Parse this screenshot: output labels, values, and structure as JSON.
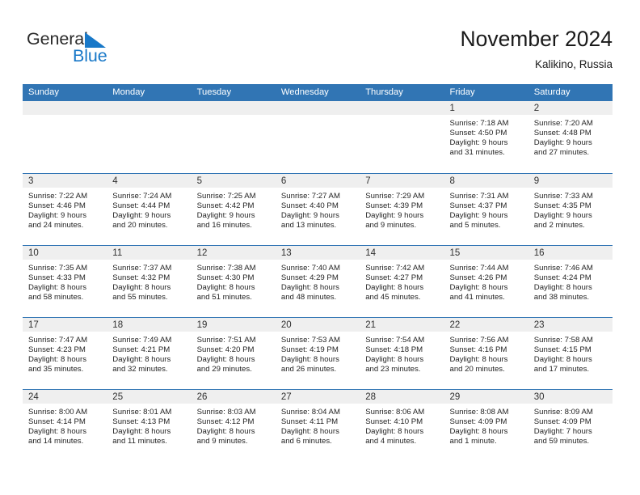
{
  "brand": {
    "name_top": "General",
    "name_bottom": "Blue",
    "triangle_color": "#1878c8",
    "text_color": "#2b2b2b"
  },
  "header": {
    "title": "November 2024",
    "subtitle": "Kalikino, Russia"
  },
  "theme": {
    "header_blue": "#3175b4",
    "daynum_band": "#efefef",
    "text": "#242424"
  },
  "weekdays": [
    "Sunday",
    "Monday",
    "Tuesday",
    "Wednesday",
    "Thursday",
    "Friday",
    "Saturday"
  ],
  "weeks": [
    [
      {
        "day": "",
        "sunrise": "",
        "sunset": "",
        "daylight_line1": "",
        "daylight_line2": ""
      },
      {
        "day": "",
        "sunrise": "",
        "sunset": "",
        "daylight_line1": "",
        "daylight_line2": ""
      },
      {
        "day": "",
        "sunrise": "",
        "sunset": "",
        "daylight_line1": "",
        "daylight_line2": ""
      },
      {
        "day": "",
        "sunrise": "",
        "sunset": "",
        "daylight_line1": "",
        "daylight_line2": ""
      },
      {
        "day": "",
        "sunrise": "",
        "sunset": "",
        "daylight_line1": "",
        "daylight_line2": ""
      },
      {
        "day": "1",
        "sunrise": "Sunrise: 7:18 AM",
        "sunset": "Sunset: 4:50 PM",
        "daylight_line1": "Daylight: 9 hours",
        "daylight_line2": "and 31 minutes."
      },
      {
        "day": "2",
        "sunrise": "Sunrise: 7:20 AM",
        "sunset": "Sunset: 4:48 PM",
        "daylight_line1": "Daylight: 9 hours",
        "daylight_line2": "and 27 minutes."
      }
    ],
    [
      {
        "day": "3",
        "sunrise": "Sunrise: 7:22 AM",
        "sunset": "Sunset: 4:46 PM",
        "daylight_line1": "Daylight: 9 hours",
        "daylight_line2": "and 24 minutes."
      },
      {
        "day": "4",
        "sunrise": "Sunrise: 7:24 AM",
        "sunset": "Sunset: 4:44 PM",
        "daylight_line1": "Daylight: 9 hours",
        "daylight_line2": "and 20 minutes."
      },
      {
        "day": "5",
        "sunrise": "Sunrise: 7:25 AM",
        "sunset": "Sunset: 4:42 PM",
        "daylight_line1": "Daylight: 9 hours",
        "daylight_line2": "and 16 minutes."
      },
      {
        "day": "6",
        "sunrise": "Sunrise: 7:27 AM",
        "sunset": "Sunset: 4:40 PM",
        "daylight_line1": "Daylight: 9 hours",
        "daylight_line2": "and 13 minutes."
      },
      {
        "day": "7",
        "sunrise": "Sunrise: 7:29 AM",
        "sunset": "Sunset: 4:39 PM",
        "daylight_line1": "Daylight: 9 hours",
        "daylight_line2": "and 9 minutes."
      },
      {
        "day": "8",
        "sunrise": "Sunrise: 7:31 AM",
        "sunset": "Sunset: 4:37 PM",
        "daylight_line1": "Daylight: 9 hours",
        "daylight_line2": "and 5 minutes."
      },
      {
        "day": "9",
        "sunrise": "Sunrise: 7:33 AM",
        "sunset": "Sunset: 4:35 PM",
        "daylight_line1": "Daylight: 9 hours",
        "daylight_line2": "and 2 minutes."
      }
    ],
    [
      {
        "day": "10",
        "sunrise": "Sunrise: 7:35 AM",
        "sunset": "Sunset: 4:33 PM",
        "daylight_line1": "Daylight: 8 hours",
        "daylight_line2": "and 58 minutes."
      },
      {
        "day": "11",
        "sunrise": "Sunrise: 7:37 AM",
        "sunset": "Sunset: 4:32 PM",
        "daylight_line1": "Daylight: 8 hours",
        "daylight_line2": "and 55 minutes."
      },
      {
        "day": "12",
        "sunrise": "Sunrise: 7:38 AM",
        "sunset": "Sunset: 4:30 PM",
        "daylight_line1": "Daylight: 8 hours",
        "daylight_line2": "and 51 minutes."
      },
      {
        "day": "13",
        "sunrise": "Sunrise: 7:40 AM",
        "sunset": "Sunset: 4:29 PM",
        "daylight_line1": "Daylight: 8 hours",
        "daylight_line2": "and 48 minutes."
      },
      {
        "day": "14",
        "sunrise": "Sunrise: 7:42 AM",
        "sunset": "Sunset: 4:27 PM",
        "daylight_line1": "Daylight: 8 hours",
        "daylight_line2": "and 45 minutes."
      },
      {
        "day": "15",
        "sunrise": "Sunrise: 7:44 AM",
        "sunset": "Sunset: 4:26 PM",
        "daylight_line1": "Daylight: 8 hours",
        "daylight_line2": "and 41 minutes."
      },
      {
        "day": "16",
        "sunrise": "Sunrise: 7:46 AM",
        "sunset": "Sunset: 4:24 PM",
        "daylight_line1": "Daylight: 8 hours",
        "daylight_line2": "and 38 minutes."
      }
    ],
    [
      {
        "day": "17",
        "sunrise": "Sunrise: 7:47 AM",
        "sunset": "Sunset: 4:23 PM",
        "daylight_line1": "Daylight: 8 hours",
        "daylight_line2": "and 35 minutes."
      },
      {
        "day": "18",
        "sunrise": "Sunrise: 7:49 AM",
        "sunset": "Sunset: 4:21 PM",
        "daylight_line1": "Daylight: 8 hours",
        "daylight_line2": "and 32 minutes."
      },
      {
        "day": "19",
        "sunrise": "Sunrise: 7:51 AM",
        "sunset": "Sunset: 4:20 PM",
        "daylight_line1": "Daylight: 8 hours",
        "daylight_line2": "and 29 minutes."
      },
      {
        "day": "20",
        "sunrise": "Sunrise: 7:53 AM",
        "sunset": "Sunset: 4:19 PM",
        "daylight_line1": "Daylight: 8 hours",
        "daylight_line2": "and 26 minutes."
      },
      {
        "day": "21",
        "sunrise": "Sunrise: 7:54 AM",
        "sunset": "Sunset: 4:18 PM",
        "daylight_line1": "Daylight: 8 hours",
        "daylight_line2": "and 23 minutes."
      },
      {
        "day": "22",
        "sunrise": "Sunrise: 7:56 AM",
        "sunset": "Sunset: 4:16 PM",
        "daylight_line1": "Daylight: 8 hours",
        "daylight_line2": "and 20 minutes."
      },
      {
        "day": "23",
        "sunrise": "Sunrise: 7:58 AM",
        "sunset": "Sunset: 4:15 PM",
        "daylight_line1": "Daylight: 8 hours",
        "daylight_line2": "and 17 minutes."
      }
    ],
    [
      {
        "day": "24",
        "sunrise": "Sunrise: 8:00 AM",
        "sunset": "Sunset: 4:14 PM",
        "daylight_line1": "Daylight: 8 hours",
        "daylight_line2": "and 14 minutes."
      },
      {
        "day": "25",
        "sunrise": "Sunrise: 8:01 AM",
        "sunset": "Sunset: 4:13 PM",
        "daylight_line1": "Daylight: 8 hours",
        "daylight_line2": "and 11 minutes."
      },
      {
        "day": "26",
        "sunrise": "Sunrise: 8:03 AM",
        "sunset": "Sunset: 4:12 PM",
        "daylight_line1": "Daylight: 8 hours",
        "daylight_line2": "and 9 minutes."
      },
      {
        "day": "27",
        "sunrise": "Sunrise: 8:04 AM",
        "sunset": "Sunset: 4:11 PM",
        "daylight_line1": "Daylight: 8 hours",
        "daylight_line2": "and 6 minutes."
      },
      {
        "day": "28",
        "sunrise": "Sunrise: 8:06 AM",
        "sunset": "Sunset: 4:10 PM",
        "daylight_line1": "Daylight: 8 hours",
        "daylight_line2": "and 4 minutes."
      },
      {
        "day": "29",
        "sunrise": "Sunrise: 8:08 AM",
        "sunset": "Sunset: 4:09 PM",
        "daylight_line1": "Daylight: 8 hours",
        "daylight_line2": "and 1 minute."
      },
      {
        "day": "30",
        "sunrise": "Sunrise: 8:09 AM",
        "sunset": "Sunset: 4:09 PM",
        "daylight_line1": "Daylight: 7 hours",
        "daylight_line2": "and 59 minutes."
      }
    ]
  ]
}
